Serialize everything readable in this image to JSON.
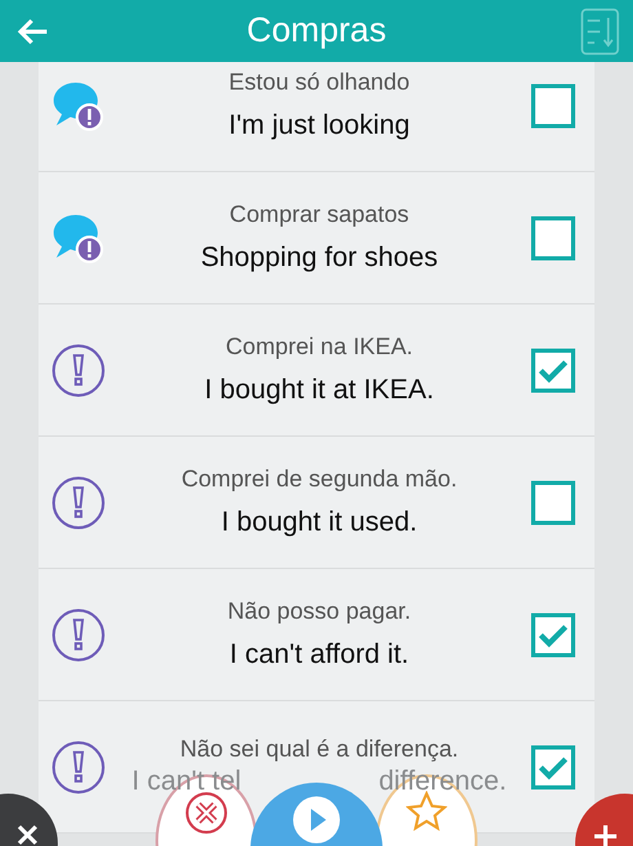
{
  "header": {
    "title": "Compras"
  },
  "phrases": [
    {
      "kind": "chat",
      "portuguese": "Estou só olhando",
      "english": "I'm just looking",
      "checked": false
    },
    {
      "kind": "chat",
      "portuguese": "Comprar sapatos",
      "english": "Shopping for shoes",
      "checked": false
    },
    {
      "kind": "alert",
      "portuguese": "Comprei na IKEA.",
      "english": "I bought it at IKEA.",
      "checked": true
    },
    {
      "kind": "alert",
      "portuguese": "Comprei de segunda mão.",
      "english": "I bought it used.",
      "checked": false
    },
    {
      "kind": "alert",
      "portuguese": "Não posso pagar.",
      "english": "I can't afford it.",
      "checked": true
    },
    {
      "kind": "alert",
      "portuguese": "Não sei qual é a diferença.",
      "english_fragments": [
        "I can't tel",
        "difference."
      ],
      "checked": true
    }
  ]
}
